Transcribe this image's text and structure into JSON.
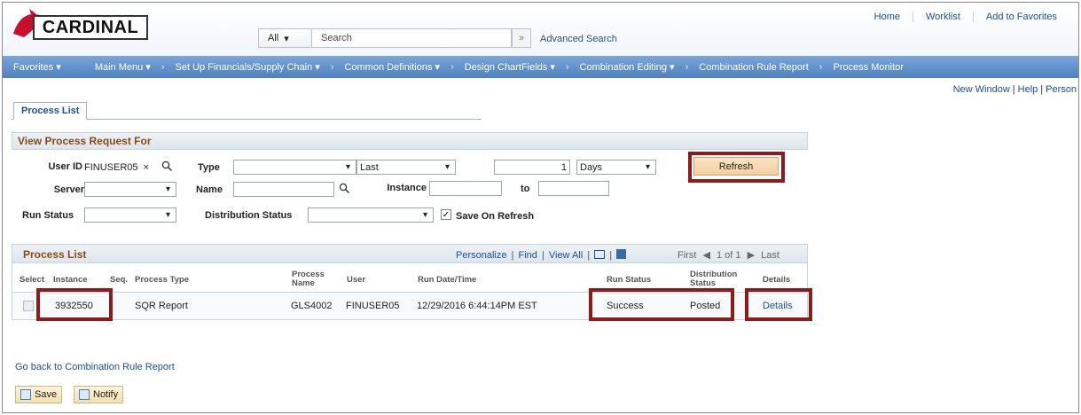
{
  "header": {
    "logo_text": "CARDINAL",
    "search_scope": "All",
    "search_placeholder": "Search",
    "advanced_search": "Advanced Search",
    "top_links": [
      "Home",
      "Worklist",
      "Add to Favorites"
    ]
  },
  "nav": {
    "items": [
      "Favorites ▾",
      "Main Menu ▾",
      "Set Up Financials/Supply Chain ▾",
      "Common Definitions ▾",
      "Design ChartFields ▾",
      "Combination Editing ▾",
      "Combination Rule Report",
      "Process Monitor"
    ]
  },
  "page_links": {
    "new_window": "New Window",
    "help": "Help",
    "personalize": "Person"
  },
  "tab": {
    "label": "Process List"
  },
  "request": {
    "section_title": "View Process Request For",
    "user_id_label": "User ID",
    "user_id_value": "FINUSER05",
    "type_label": "Type",
    "type_value": "",
    "last_value": "Last",
    "count_value": "1",
    "unit_value": "Days",
    "refresh_label": "Refresh",
    "server_label": "Server",
    "name_label": "Name",
    "instance_label": "Instance",
    "to_label": "to",
    "run_status_label": "Run Status",
    "dist_status_label": "Distribution Status",
    "save_on_refresh_label": "Save On Refresh"
  },
  "grid": {
    "title": "Process List",
    "personalize": "Personalize",
    "find": "Find",
    "view_all": "View All",
    "first": "First",
    "page_info": "1 of 1",
    "last": "Last",
    "columns": {
      "select": "Select",
      "instance": "Instance",
      "seq": "Seq.",
      "process_type": "Process Type",
      "process_name": "Process Name",
      "user": "User",
      "run_datetime": "Run Date/Time",
      "run_status": "Run Status",
      "dist_status": "Distribution Status",
      "details": "Details"
    },
    "row": {
      "instance": "3932550",
      "seq": "",
      "process_type": "SQR Report",
      "process_name": "GLS4002",
      "user": "FINUSER05",
      "run_datetime": "12/29/2016  6:44:14PM EST",
      "run_status": "Success",
      "dist_status": "Posted",
      "details": "Details"
    }
  },
  "footer": {
    "back_link": "Go back to Combination Rule Report",
    "save_label": "Save",
    "notify_label": "Notify"
  }
}
